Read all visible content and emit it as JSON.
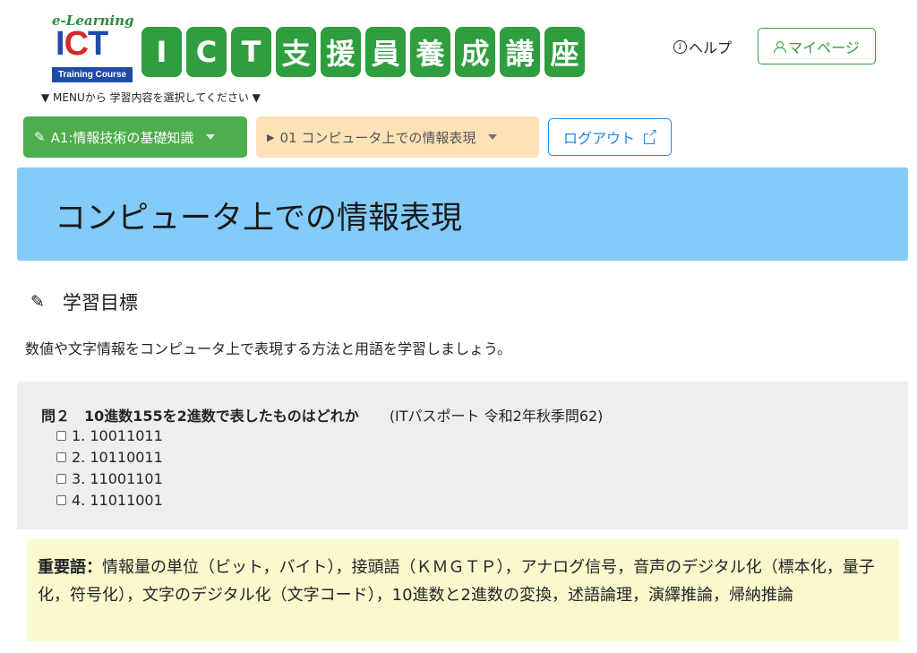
{
  "logo": {
    "elearning": "e-Learning",
    "ict_i": "I",
    "ict_c": "C",
    "ict_t": "T",
    "training": "Training Course"
  },
  "site_title_chars": [
    "I",
    "C",
    "T",
    "支",
    "援",
    "員",
    "養",
    "成",
    "講",
    "座"
  ],
  "header": {
    "help_label": "ヘルプ",
    "mypage_label": "マイページ",
    "menu_hint": "▼ MENUから 学習内容を選択してください ▼"
  },
  "nav": {
    "category_label": "A1:情報技術の基礎知識",
    "topic_label": "01 コンピュータ上での情報表現",
    "logout_label": "ログアウト"
  },
  "page": {
    "title": "コンピュータ上での情報表現",
    "objective_heading": "学習目標",
    "objective_text": "数値や文字情報をコンピュータ上で表現する方法と用語を学習しましょう。"
  },
  "question": {
    "label": "問２　10進数155を2進数で表したものはどれか",
    "source": "(ITパスポート 令和2年秋季問62)",
    "options": [
      "1. 10011011",
      "2. 10110011",
      "3. 11001101",
      "4. 11011001"
    ]
  },
  "keywords": {
    "label": "重要語：",
    "text": "情報量の単位（ビット，バイト），接頭語（ＫＭＧＴＰ），アナログ信号，音声のデジタル化（標本化，量子化，符号化），文字のデジタル化（文字コード），10進数と2進数の変換，述語論理，演繹推論，帰納推論"
  },
  "colors": {
    "brand_green": "#2f9e3f",
    "banner_blue": "#82cbfa",
    "topic_orange": "#fde2b8",
    "link_blue": "#1e88e5",
    "keyword_bg": "#fbf8cd"
  }
}
